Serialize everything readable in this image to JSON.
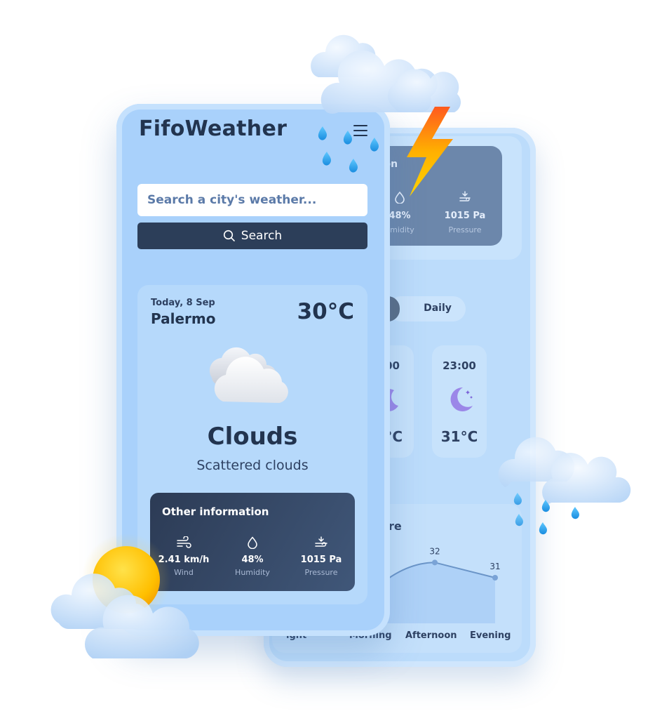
{
  "front": {
    "app_title": "FifoWeather",
    "search_placeholder": "Search a city's weather...",
    "search_button": "Search",
    "date": "Today, 8 Sep",
    "city": "Palermo",
    "temperature": "30°C",
    "condition": "Clouds",
    "description": "Scattered clouds",
    "other_info": {
      "title": "Other information",
      "items": [
        {
          "icon": "wind-icon",
          "value": "2.41 km/h",
          "label": "Wind"
        },
        {
          "icon": "droplet-icon",
          "value": "48%",
          "label": "Humidity"
        },
        {
          "icon": "pressure-icon",
          "value": "1015 Pa",
          "label": "Pressure"
        }
      ]
    }
  },
  "back": {
    "info_partial": {
      "title_fragment": "tion",
      "items": [
        {
          "icon": "droplet-icon",
          "value": "48%",
          "label": "umidity"
        },
        {
          "icon": "pressure-icon",
          "value": "1015 Pa",
          "label": "Pressure"
        }
      ]
    },
    "tabs": {
      "daily": "Daily"
    },
    "hourly": [
      {
        "time": "00",
        "temp": "°C"
      },
      {
        "time": "23:00",
        "temp": "31°C"
      }
    ],
    "chart": {
      "title_fragment": "re",
      "x_labels": [
        "ight",
        "Morning",
        "Afternoon",
        "Evening"
      ],
      "value_labels": [
        "32",
        "31"
      ]
    }
  },
  "chart_data": {
    "type": "line",
    "categories": [
      "Night",
      "Morning",
      "Afternoon",
      "Evening"
    ],
    "values": [
      null,
      null,
      32,
      31
    ]
  },
  "colors": {
    "accent_dark": "#2c3e59",
    "phone_front": "#a9d1fb",
    "phone_back": "#bcdcfb",
    "bolt": "#ffb000"
  }
}
